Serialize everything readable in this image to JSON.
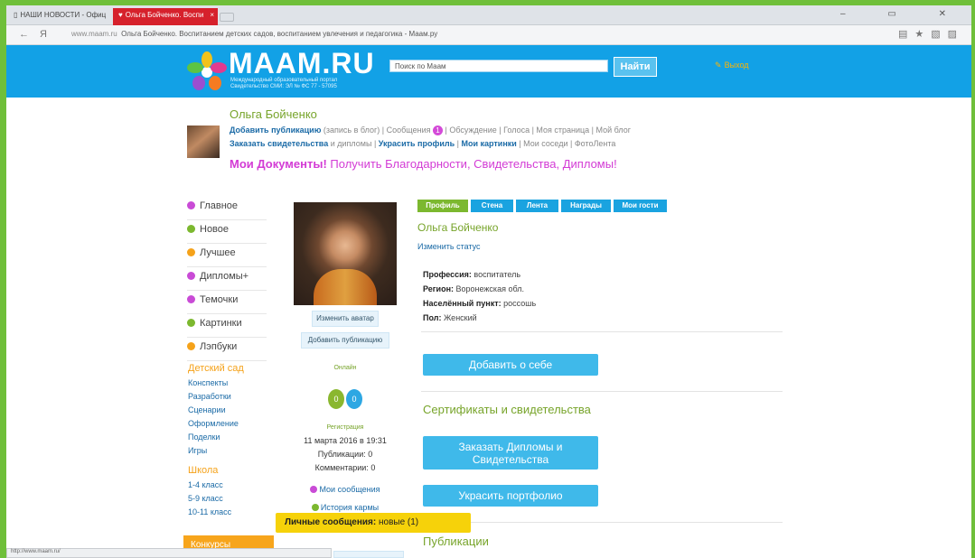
{
  "browser": {
    "tabs": [
      {
        "label": "НАШИ НОВОСТИ - Офиц"
      },
      {
        "label": "Ольга Бойченко. Воспи"
      }
    ],
    "url": "www.maam.ru",
    "page_title": "Ольга Бойченко. Воспитанием детских садов, воспитанием увлечения и педагогика - Маам.ру",
    "status_url": "http://www.maam.ru/"
  },
  "header": {
    "logo": "MAAM.RU",
    "tagline_1": "Международный образовательный портал",
    "tagline_2": "Свидетельство СМИ: ЭЛ № ФС 77 - 57095",
    "search_placeholder": "Поиск по Маам",
    "search_button": "Найти",
    "exit": "Выход"
  },
  "user": {
    "name": "Ольга Бойченко",
    "links1": {
      "add": "Добавить публикацию",
      "blog": "(запись в блог)",
      "messages": "Сообщения",
      "count": "1",
      "rest": "Обсуждение | Голоса | Моя страница | Мой блог"
    },
    "links2": {
      "order": "Заказать свидетельства",
      "diplomas": "и дипломы",
      "decorate": "Украсить профиль",
      "pictures": "Мои картинки",
      "rest": "Мои соседи | ФотоЛента"
    },
    "docs_title": "Мои Документы!",
    "docs_text": "Получить Благодарности, Свидетельства, Дипломы!"
  },
  "left_menu": [
    {
      "label": "Главное",
      "color": "#c94bd6"
    },
    {
      "label": "Новое",
      "color": "#7cb82f"
    },
    {
      "label": "Лучшее",
      "color": "#f5a21a"
    },
    {
      "label": "Дипломы+",
      "color": "#c94bd6"
    },
    {
      "label": "Темочки",
      "color": "#c94bd6"
    },
    {
      "label": "Картинки",
      "color": "#7cb82f"
    },
    {
      "label": "Лэпбуки",
      "color": "#f5a21a"
    }
  ],
  "kindergarten": {
    "title": "Детский сад",
    "items": [
      "Конспекты",
      "Разработки",
      "Сценарии",
      "Оформление",
      "Поделки",
      "Игры"
    ]
  },
  "school": {
    "title": "Школа",
    "items": [
      "1-4 класс",
      "5-9 класс",
      "10-11 класс"
    ]
  },
  "contests": "Конкурсы",
  "profile_col": {
    "change_avatar": "Изменить аватар",
    "add_publication": "Добавить публикацию",
    "online": "Онлайн",
    "count_a": "0",
    "count_b": "0",
    "registration_label": "Регистрация",
    "registration_date": "11 марта 2016 в 19:31",
    "publications": "Публикации: 0",
    "comments": "Комментарии: 0",
    "my_messages": "Мои сообщения",
    "karma": "История кармы"
  },
  "profile_tabs": [
    "Профиль",
    "Стена",
    "Лента",
    "Награды",
    "Мои гости"
  ],
  "profile": {
    "name": "Ольга Бойченко",
    "change_status": "Изменить статус",
    "profession_label": "Профессия:",
    "profession": "воспитатель",
    "region_label": "Регион:",
    "region": "Воронежская обл.",
    "city_label": "Населённый пункт:",
    "city": "россошь",
    "gender_label": "Пол:",
    "gender": "Женский",
    "about_button": "Добавить о себе",
    "certs_title": "Сертификаты и свидетельства",
    "order_button": "Заказать Дипломы и Свидетельства",
    "portfolio_button": "Украсить портфолио",
    "publications_title": "Публикации"
  },
  "notification": {
    "label": "Личные сообщения:",
    "value": "новые (1)"
  }
}
